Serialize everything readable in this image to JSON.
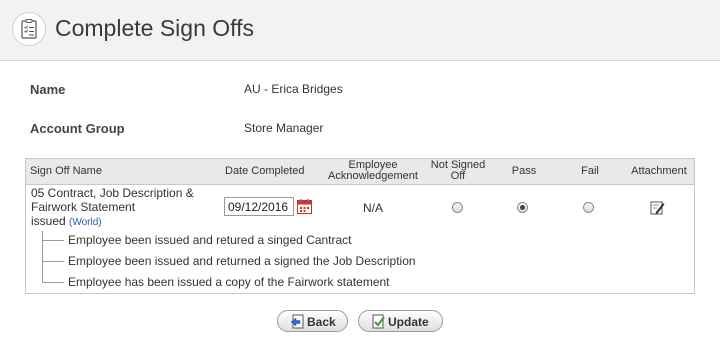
{
  "header": {
    "title": "Complete Sign Offs",
    "icon": "checklist-icon"
  },
  "fields": {
    "name_label": "Name",
    "name_value": "AU - Erica Bridges",
    "account_group_label": "Account Group",
    "account_group_value": "Store Manager"
  },
  "table": {
    "columns": {
      "sign_off_name": "Sign Off Name",
      "date_completed": "Date Completed",
      "employee_ack_line1": "Employee",
      "employee_ack_line2": "Acknowledgement",
      "not_signed_off_line1": "Not Signed",
      "not_signed_off_line2": "Off",
      "pass": "Pass",
      "fail": "Fail",
      "attachment": "Attachment"
    },
    "row": {
      "name_line1": "05 Contract, Job Description &",
      "name_line2": "Fairwork Statement",
      "name_line3": "issued",
      "scope": "(World)",
      "date_completed": "09/12/2016",
      "employee_ack": "N/A",
      "selected_status": "Pass",
      "sub_items": [
        "Employee been issued and retured a singed Cantract",
        "Employee been issued and returned a signed the Job Description",
        "Employee has been issued a copy of the Fairwork statement"
      ]
    }
  },
  "buttons": {
    "back": "Back",
    "update": "Update"
  },
  "icons": {
    "calendar": "calendar-icon",
    "attachment": "edit-attachment-icon",
    "back": "back-icon",
    "update": "update-icon"
  },
  "colors": {
    "header_bg": "#f2f2f2",
    "link": "#2a5db0",
    "calendar_red": "#d0342c"
  }
}
